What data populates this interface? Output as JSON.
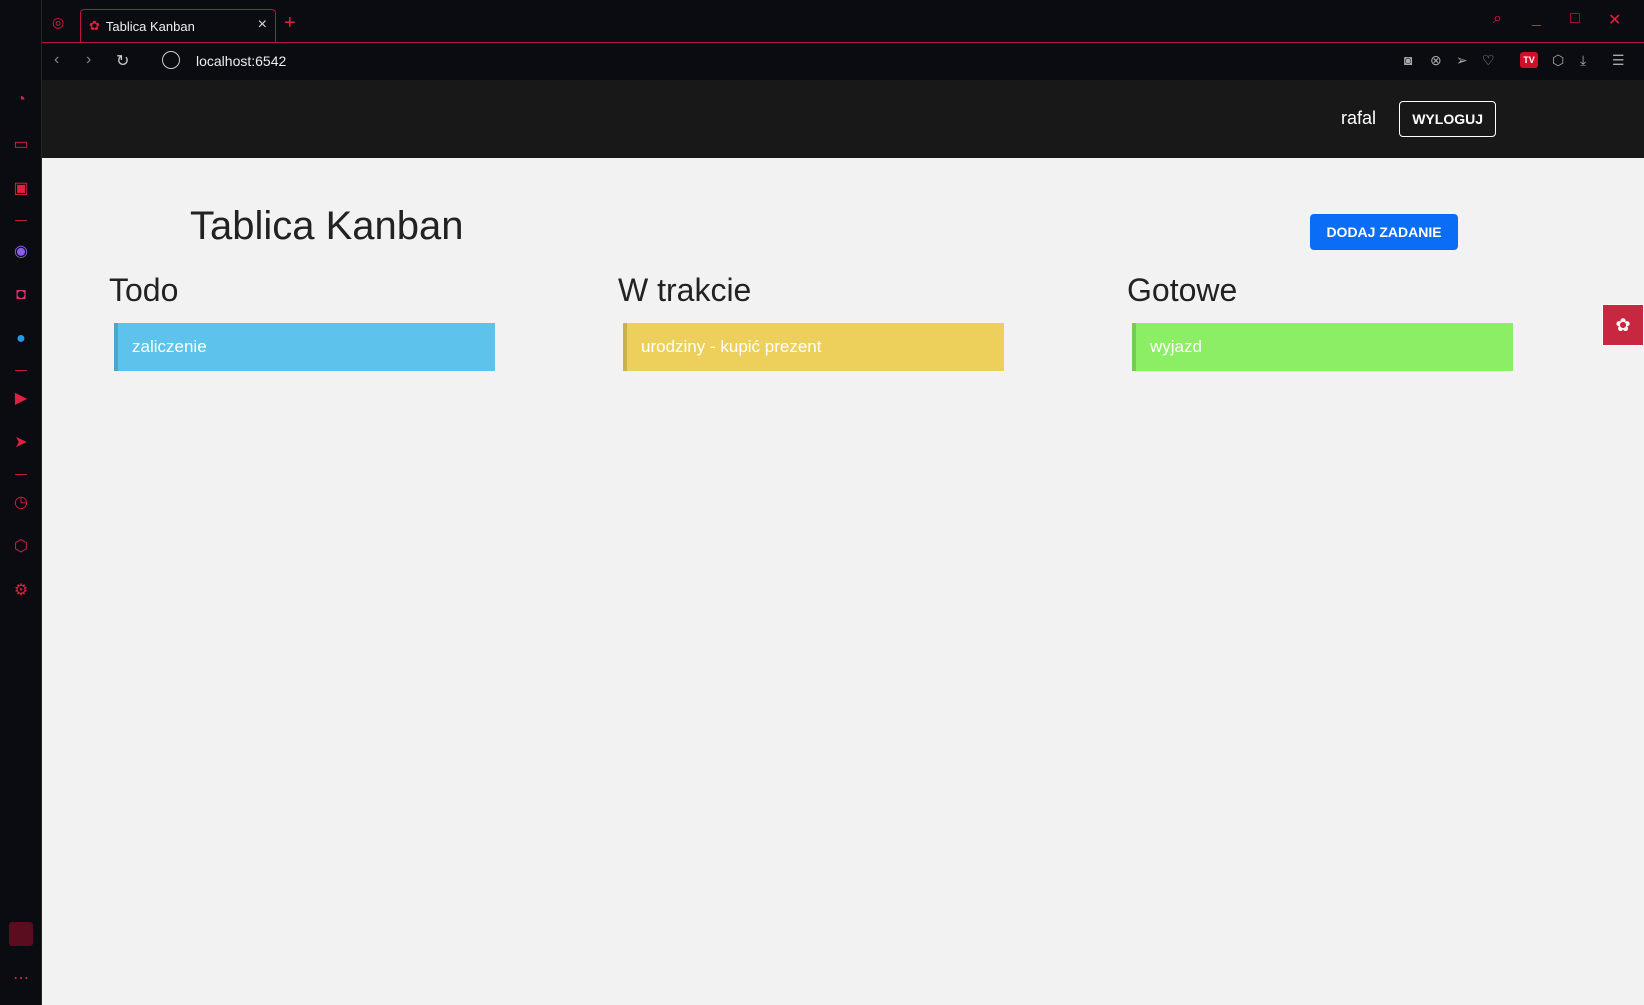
{
  "browser": {
    "tab_title": "Tablica Kanban",
    "url": "localhost:6542"
  },
  "app": {
    "username": "rafal",
    "logout_label": "WYLOGUJ",
    "title": "Tablica Kanban",
    "add_task_label": "DODAJ ZADANIE",
    "columns": [
      {
        "title": "Todo",
        "cards": [
          {
            "text": "zaliczenie",
            "color": "#5ec3ec"
          }
        ]
      },
      {
        "title": "W trakcie",
        "cards": [
          {
            "text": "urodziny - kupić prezent",
            "color": "#edd05c"
          }
        ]
      },
      {
        "title": "Gotowe",
        "cards": [
          {
            "text": "wyjazd",
            "color": "#8cee64"
          }
        ]
      }
    ]
  },
  "colors": {
    "accent": "#e0203f",
    "primary_button": "#0b6cf5",
    "navbar": "#181818",
    "page_bg": "#f2f2f2"
  }
}
